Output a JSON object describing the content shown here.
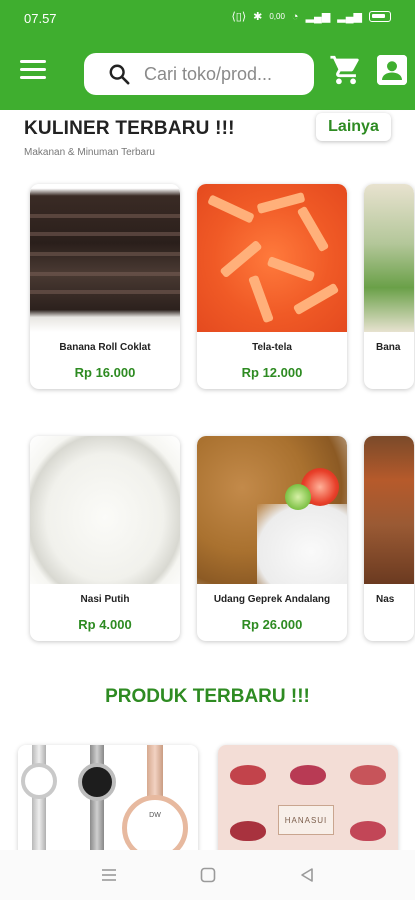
{
  "status_bar": {
    "time": "07.57",
    "net_speed": "0,00"
  },
  "header": {
    "search_placeholder": "Cari toko/prod...",
    "accent_color": "#3fae2f"
  },
  "section_kuliner": {
    "title": "KULINER TERBARU !!!",
    "subtitle": "Makanan & Minuman Terbaru",
    "more_label": "Lainya",
    "row1": [
      {
        "name": "Banana Roll Coklat",
        "price": "Rp 16.000"
      },
      {
        "name": "Tela-tela",
        "price": "Rp 12.000"
      },
      {
        "name": "Bana"
      }
    ],
    "row2": [
      {
        "name": "Nasi Putih",
        "price": "Rp 4.000"
      },
      {
        "name": "Udang Geprek Andalang",
        "price": "Rp 26.000"
      },
      {
        "name": "Nas"
      }
    ]
  },
  "section_produk": {
    "title": "PRODUK TERBARU !!!",
    "items": [
      {
        "brand_text": "DW"
      },
      {
        "brand_text": "HANASUI"
      }
    ]
  },
  "icons": {
    "menu": "hamburger-menu-icon",
    "search": "search-icon",
    "cart": "cart-icon",
    "account": "account-icon"
  }
}
